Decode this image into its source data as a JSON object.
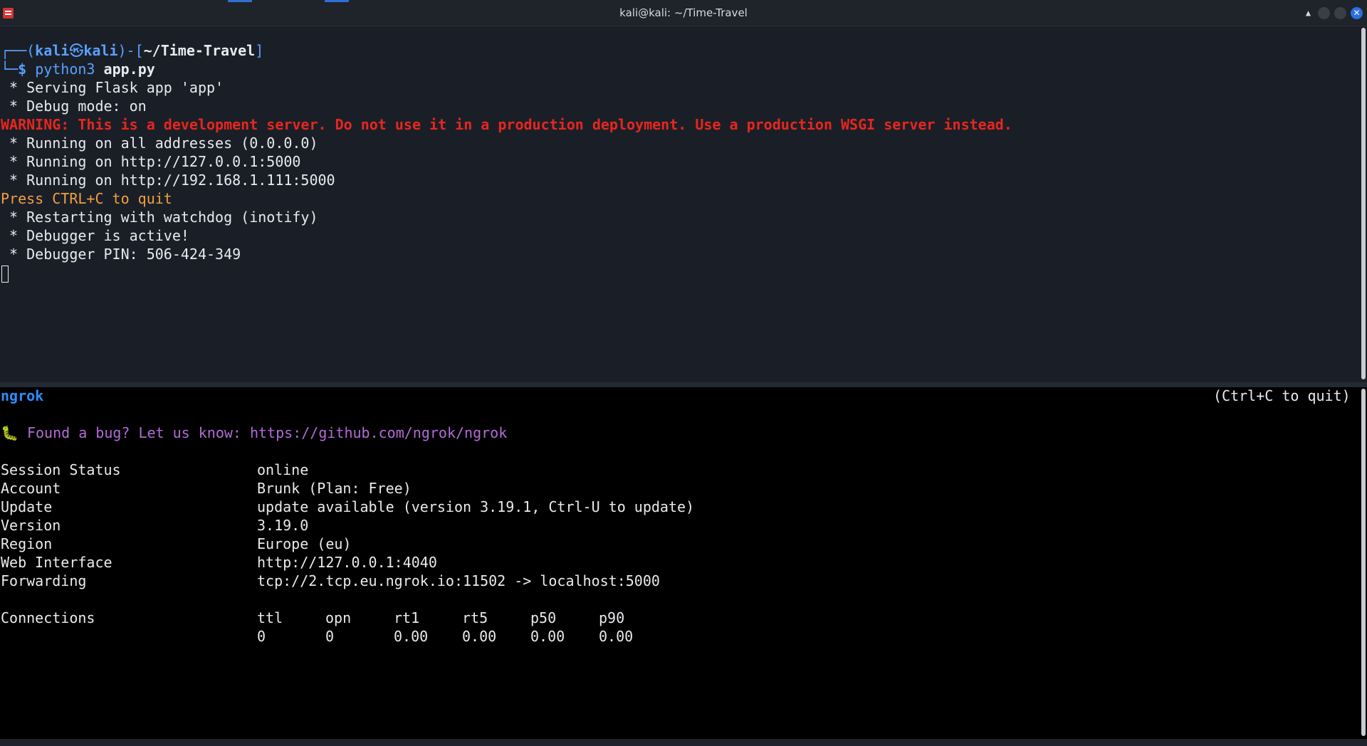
{
  "window": {
    "title": "kali@kali: ~/Time-Travel",
    "close_glyph": "✕",
    "up_glyph": "▲"
  },
  "top_terminal": {
    "prompt": {
      "open": "┌──(",
      "user": "kali",
      "at": "㉿",
      "host": "kali",
      "mid": ")-[",
      "path": "~/Time-Travel",
      "close": "]",
      "line2_prefix": "└─",
      "dollar": "$ ",
      "command": "python3",
      "arg": " app.py"
    },
    "output": [
      " * Serving Flask app 'app'",
      " * Debug mode: on"
    ],
    "warning": "WARNING: This is a development server. Do not use it in a production deployment. Use a production WSGI server instead.",
    "running": [
      " * Running on all addresses (0.0.0.0)",
      " * Running on http://127.0.0.1:5000",
      " * Running on http://192.168.1.111:5000"
    ],
    "quit_hint": "Press CTRL+C to quit",
    "after": [
      " * Restarting with watchdog (inotify)",
      " * Debugger is active!",
      " * Debugger PIN: 506-424-349"
    ]
  },
  "ngrok": {
    "name": "ngrok",
    "quit_hint": "(Ctrl+C to quit)",
    "bug_line": "🐛 Found a bug? Let us know: https://github.com/ngrok/ngrok",
    "rows": [
      {
        "label": "Session Status",
        "value": "online"
      },
      {
        "label": "Account",
        "value": "Brunk (Plan: Free)"
      },
      {
        "label": "Update",
        "value": "update available (version 3.19.1, Ctrl-U to update)"
      },
      {
        "label": "Version",
        "value": "3.19.0"
      },
      {
        "label": "Region",
        "value": "Europe (eu)"
      },
      {
        "label": "Web Interface",
        "value": "http://127.0.0.1:4040"
      },
      {
        "label": "Forwarding",
        "value": "tcp://2.tcp.eu.ngrok.io:11502 -> localhost:5000"
      }
    ],
    "connections": {
      "label": "Connections",
      "headers": [
        "ttl",
        "opn",
        "rt1",
        "rt5",
        "p50",
        "p90"
      ],
      "values": [
        "0",
        "0",
        "0.00",
        "0.00",
        "0.00",
        "0.00"
      ]
    }
  },
  "colors": {
    "terminal_bg": "#1a1f27",
    "warning": "#e8261e",
    "prompt_blue": "#5aa0ff",
    "ngrok_teal": "#43c4a8",
    "ngrok_orange": "#f0a042"
  }
}
